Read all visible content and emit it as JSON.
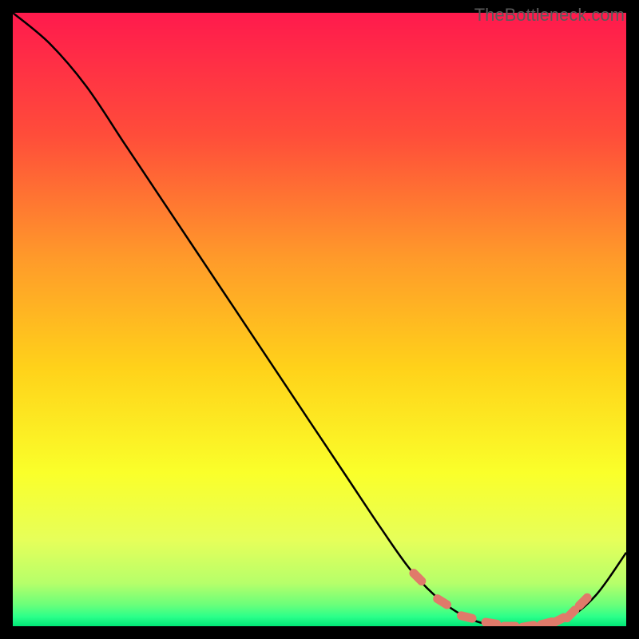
{
  "watermark": "TheBottleneck.com",
  "chart_data": {
    "type": "line",
    "title": "",
    "xlabel": "",
    "ylabel": "",
    "xlim": [
      0,
      100
    ],
    "ylim": [
      0,
      100
    ],
    "grid": false,
    "series": [
      {
        "name": "curve",
        "x": [
          0,
          6,
          12,
          18,
          24,
          30,
          36,
          42,
          48,
          54,
          60,
          65,
          70,
          75,
          80,
          85,
          90,
          95,
          100
        ],
        "values": [
          100,
          95,
          88,
          79,
          70,
          61,
          52,
          43,
          34,
          25,
          16,
          9,
          4,
          1,
          0,
          0,
          1,
          5,
          12
        ]
      }
    ],
    "markers": {
      "name": "highlight-dots",
      "x": [
        66,
        70,
        74,
        78,
        81,
        84,
        87,
        89,
        91,
        93
      ],
      "values": [
        8,
        4,
        1.5,
        0.5,
        0,
        0,
        0.5,
        1,
        2,
        4
      ]
    },
    "background_gradient": [
      {
        "offset": 0.0,
        "color": "#ff1a4d"
      },
      {
        "offset": 0.2,
        "color": "#ff4d3a"
      },
      {
        "offset": 0.4,
        "color": "#ff9a2a"
      },
      {
        "offset": 0.58,
        "color": "#ffd21a"
      },
      {
        "offset": 0.75,
        "color": "#faff2a"
      },
      {
        "offset": 0.86,
        "color": "#e6ff5a"
      },
      {
        "offset": 0.93,
        "color": "#b6ff6a"
      },
      {
        "offset": 0.965,
        "color": "#6aff7a"
      },
      {
        "offset": 0.985,
        "color": "#2aff8a"
      },
      {
        "offset": 1.0,
        "color": "#00e676"
      }
    ],
    "marker_color": "#e07a6a",
    "curve_color": "#000000"
  }
}
